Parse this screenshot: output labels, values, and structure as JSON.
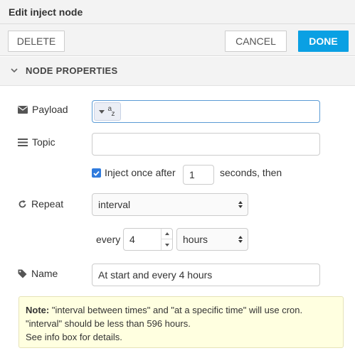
{
  "dialog": {
    "title": "Edit inject node"
  },
  "toolbar": {
    "delete_label": "DELETE",
    "cancel_label": "CANCEL",
    "done_label": "DONE"
  },
  "section": {
    "label": "NODE PROPERTIES",
    "icon": "chevron-down-icon"
  },
  "payload": {
    "label": "Payload",
    "icon": "envelope-icon",
    "type_icon": "string-type-icon",
    "value": ""
  },
  "topic": {
    "label": "Topic",
    "icon": "list-icon",
    "value": ""
  },
  "inject_once": {
    "checked": true,
    "label": "Inject once after",
    "delay_value": "1",
    "suffix": "seconds, then"
  },
  "repeat": {
    "label": "Repeat",
    "icon": "refresh-icon",
    "mode": "interval",
    "every_label": "every",
    "every_value": "4",
    "unit": "hours"
  },
  "name": {
    "label": "Name",
    "icon": "tag-icon",
    "value": "At start and every 4 hours"
  },
  "note": {
    "prefix": "Note:",
    "line1": "\"interval between times\" and \"at a specific time\" will use cron.",
    "line2": "\"interval\" should be less than 596 hours.",
    "line3": "See info box for details."
  },
  "colors": {
    "accent": "#0aa0e3",
    "checkbox": "#2f7bdd",
    "note_bg": "#ffffe0",
    "focus_border": "#5b9bd5"
  }
}
